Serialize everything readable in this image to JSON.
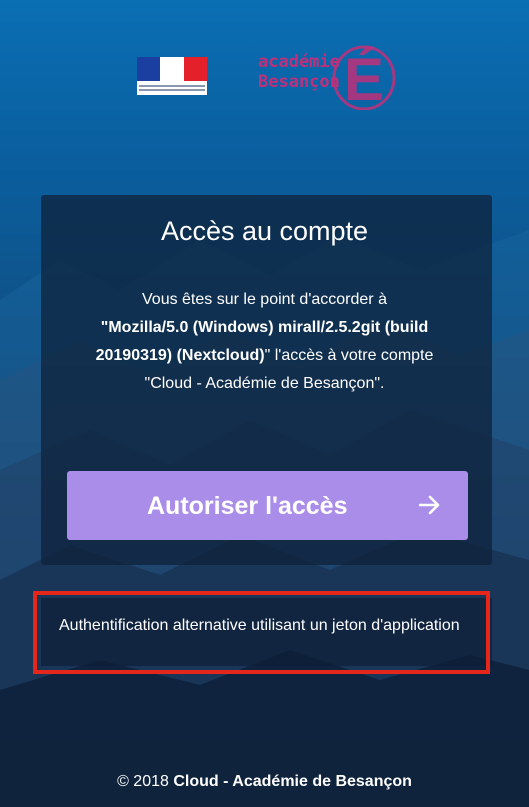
{
  "header": {
    "academie_logo": {
      "word1": "académie",
      "word2": "Besançon",
      "letter": "É"
    }
  },
  "card": {
    "title": "Accès au compte",
    "text_intro": "Vous êtes sur le point d'accorder à",
    "client_name": "\"Mozilla/5.0 (Windows) mirall/2.5.2git (build 20190319) (Nextcloud)",
    "text_middle": "\" l'accès à votre compte",
    "account_name": "\"Cloud - Académie de Besançon\".",
    "authorize_label": "Autoriser l'accès",
    "authorize_icon": "arrow-right-icon"
  },
  "alternative_auth": {
    "label": "Authentification alternative utilisant un jeton d'application",
    "highlight_color": "#e5261b"
  },
  "footer": {
    "prefix": "© 2018 ",
    "brand": "Cloud - Académie de Besançon"
  },
  "colors": {
    "primary_button": "#a98de8",
    "logo_accent": "#c0307a"
  }
}
